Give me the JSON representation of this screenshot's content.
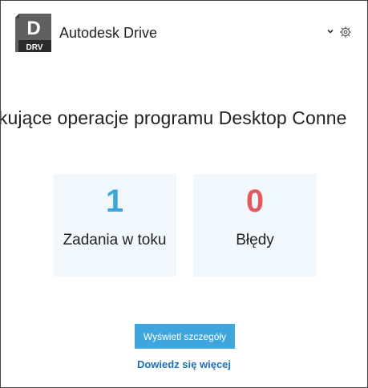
{
  "header": {
    "logo_letter": "D",
    "logo_badge": "DRV",
    "title": "Autodesk Drive",
    "icons": {
      "dropdown": "chevron-down-icon",
      "settings": "gear-icon"
    }
  },
  "main": {
    "heading": "ekujące operacje programu Desktop Conne",
    "cards": [
      {
        "value": "1",
        "label": "Zadania w toku",
        "color": "#3ea5dd"
      },
      {
        "value": "0",
        "label": "Błędy",
        "color": "#e35a5d"
      }
    ],
    "details_button_label": "Wyświetl szczegóły",
    "learn_more_label": "Dowiedz się więcej"
  },
  "colors": {
    "accent": "#3ea5dd",
    "error": "#e35a5d",
    "link": "#1d6fb8",
    "card_bg": "#f0f8fd"
  }
}
